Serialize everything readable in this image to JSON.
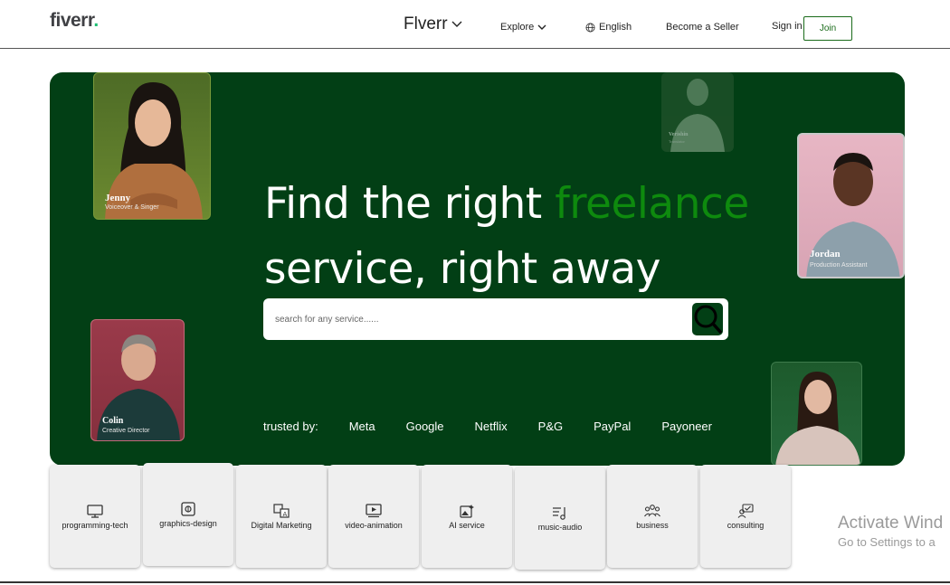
{
  "nav": {
    "logo_text": "fiverr",
    "logo_dot": ".",
    "brand": "Flverr",
    "explore": "Explore",
    "language": "English",
    "become_seller": "Become a Seller",
    "sign_in": "Sign in",
    "join": "Join"
  },
  "hero": {
    "title_part1": "Find the right ",
    "title_accent": "freelance",
    "title_part2": "service, right away",
    "search_placeholder": "search for any service......",
    "trusted_label": "trusted by:",
    "trusted_brands": [
      "Meta",
      "Google",
      "Netflix",
      "P&G",
      "PayPal",
      "Payoneer"
    ],
    "cards": {
      "jenny": {
        "name": "Jenny",
        "role": "Voiceover & Singer"
      },
      "faded": {
        "name": "Verishin",
        "role": "Translator"
      },
      "jordan": {
        "name": "Jordan",
        "role": "Production Assistant"
      },
      "colin": {
        "name": "Colin",
        "role": "Creative Director"
      }
    }
  },
  "categories": [
    {
      "label": "programming-tech",
      "icon": "monitor-icon"
    },
    {
      "label": "graphics-design",
      "icon": "design-icon"
    },
    {
      "label": "Digital Marketing",
      "icon": "translate-icon"
    },
    {
      "label": "video-animation",
      "icon": "video-icon"
    },
    {
      "label": "AI service",
      "icon": "ai-image-icon"
    },
    {
      "label": "music-audio",
      "icon": "music-icon"
    },
    {
      "label": "business",
      "icon": "people-icon"
    },
    {
      "label": "consulting",
      "icon": "consulting-icon"
    }
  ],
  "watermark": {
    "line1": "Activate Wind",
    "line2": "Go to Settings to a"
  },
  "colors": {
    "hero_bg": "#023f15",
    "accent_green": "#0e8a0e",
    "logo_dot": "#1dbf73"
  }
}
